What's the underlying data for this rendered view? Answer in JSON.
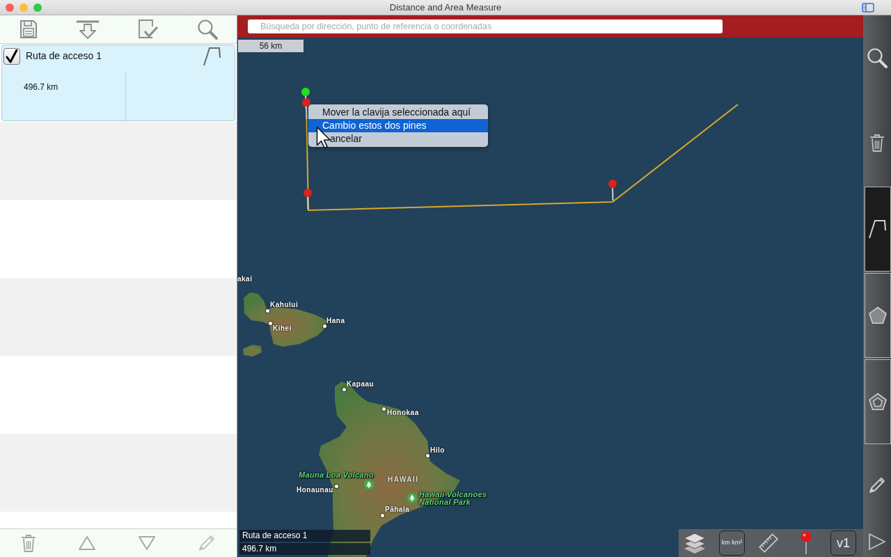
{
  "window": {
    "title": "Distance and Area Measure"
  },
  "list": {
    "items": [
      {
        "name": "Ruta de acceso 1",
        "checked": true,
        "selected": true,
        "kind": "route",
        "measure": "496.7 km"
      }
    ]
  },
  "search": {
    "placeholder": "Búsqueda por dirección, punto de referencia o coordenadas"
  },
  "map": {
    "scale": "56 km",
    "labels": [
      {
        "text": "akai",
        "kind": "place"
      },
      {
        "text": "Kahului",
        "kind": "town"
      },
      {
        "text": "Kihei",
        "kind": "town"
      },
      {
        "text": "Hana",
        "kind": "town"
      },
      {
        "text": "Kapaau",
        "kind": "town"
      },
      {
        "text": "Honokaa",
        "kind": "town"
      },
      {
        "text": "Hilo",
        "kind": "town"
      },
      {
        "text": "Mauna Loa Volcano",
        "kind": "park"
      },
      {
        "text": "HAWAII",
        "kind": "region"
      },
      {
        "text": "Honaunau",
        "kind": "town"
      },
      {
        "text": "Hawaii Volcanoes National Park",
        "kind": "park"
      },
      {
        "text": "Pāhala",
        "kind": "town"
      }
    ],
    "pins": [
      {
        "color": "#22dd22"
      },
      {
        "color": "#e0201c"
      },
      {
        "color": "#e0201c"
      },
      {
        "color": "#e0201c"
      }
    ],
    "context_menu": [
      {
        "label": "Mover la clavija seleccionada aquí",
        "selected": false
      },
      {
        "label": "Cambio estos dos pines",
        "selected": true
      },
      {
        "label": "ancelar",
        "selected": false
      }
    ],
    "route_overlay": {
      "name": "Ruta de acceso 1",
      "measure": "496.7 km"
    }
  },
  "map_toolbar": {
    "units": "km km²",
    "version": "v1"
  },
  "tools": [
    {
      "kind": "route",
      "selected": true
    },
    {
      "kind": "polygon",
      "selected": false
    },
    {
      "kind": "ring",
      "selected": false
    }
  ]
}
